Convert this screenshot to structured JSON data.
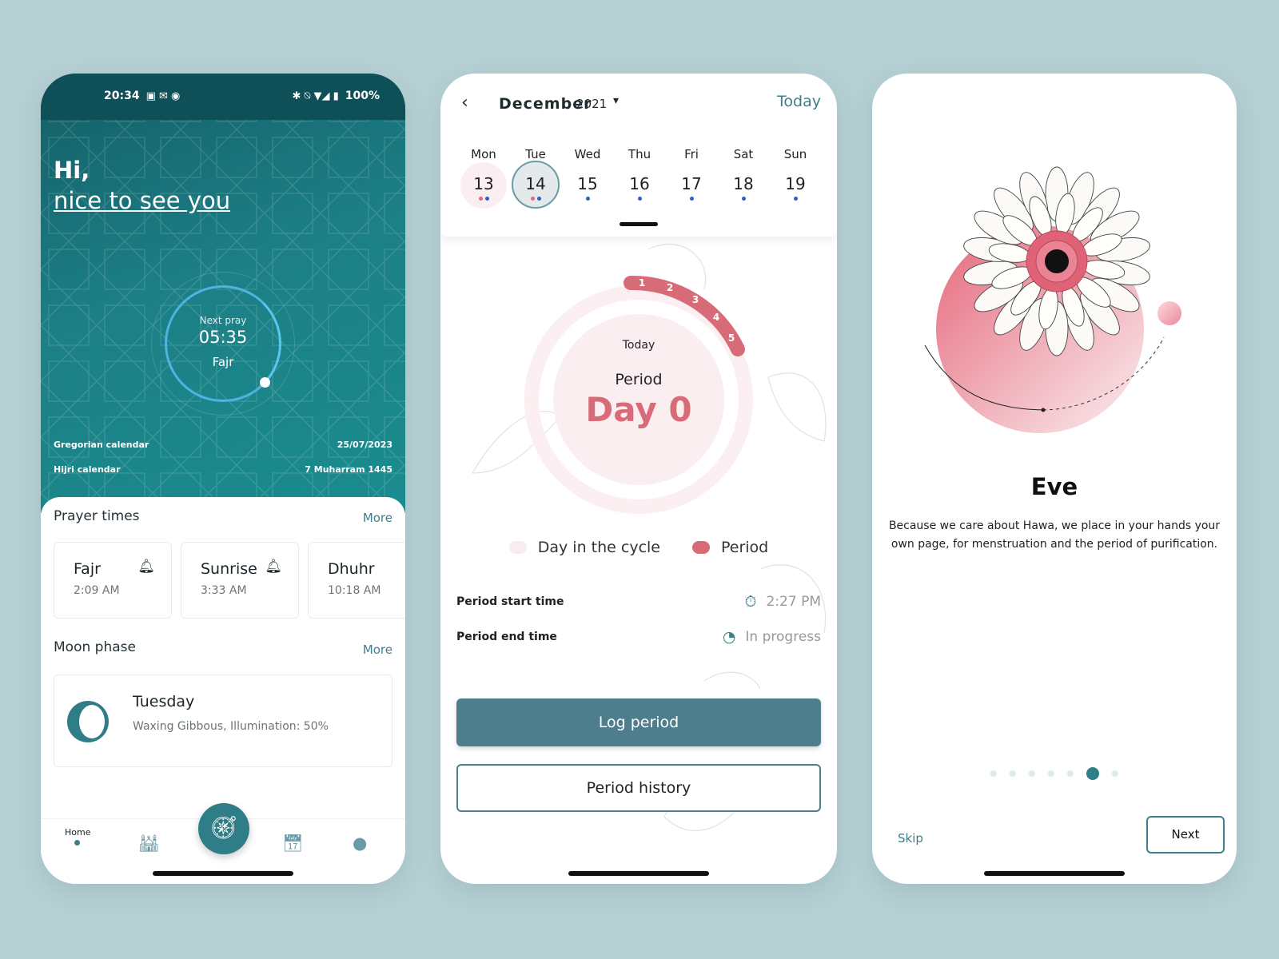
{
  "home": {
    "status_bar": {
      "time": "20:34",
      "battery": "100%"
    },
    "greeting_line1": "Hi,",
    "greeting_line2": "nice to see you",
    "next_prayer": {
      "label": "Next pray",
      "time": "05:35",
      "name": "Fajr"
    },
    "gregorian": {
      "label": "Gregorian calendar",
      "value": "25/07/2023"
    },
    "hijri": {
      "label": "Hijri calendar",
      "value": "7 Muharram 1445"
    },
    "prayer_times": {
      "title": "Prayer times",
      "more": "More",
      "items": [
        {
          "name": "Fajr",
          "time": "2:09 AM"
        },
        {
          "name": "Sunrise",
          "time": "3:33 AM"
        },
        {
          "name": "Dhuhr",
          "time": "10:18 AM"
        }
      ]
    },
    "moon_phase": {
      "title": "Moon phase",
      "more": "More",
      "day": "Tuesday",
      "description": "Waxing Gibbous, Illumination: 50%"
    },
    "nav": {
      "home_label": "Home"
    }
  },
  "cycle": {
    "month": "December",
    "year": "2021",
    "today_link": "Today",
    "week": [
      {
        "name": "Mon",
        "date": "13"
      },
      {
        "name": "Tue",
        "date": "14"
      },
      {
        "name": "Wed",
        "date": "15"
      },
      {
        "name": "Thu",
        "date": "16"
      },
      {
        "name": "Fri",
        "date": "17"
      },
      {
        "name": "Sat",
        "date": "18"
      },
      {
        "name": "Sun",
        "date": "19"
      }
    ],
    "ring_days": [
      "1",
      "2",
      "3",
      "4",
      "5"
    ],
    "today_label": "Today",
    "period_label": "Period",
    "day_label": "Day 0",
    "legend": {
      "cycle": "Day in the cycle",
      "period": "Period"
    },
    "start_time": {
      "label": "Period start time",
      "value": "2:27 PM"
    },
    "end_time": {
      "label": "Period end time",
      "value": "In progress"
    },
    "log_button": "Log period",
    "history_button": "Period history",
    "colors": {
      "accent": "#4e7d8d",
      "period": "#d86b78"
    }
  },
  "onboarding": {
    "title": "Eve",
    "description": "Because we care about Hawa, we place in your hands your own page, for menstruation and the period of purification.",
    "pager": {
      "count": 7,
      "active": 5
    },
    "skip": "Skip",
    "next": "Next"
  }
}
